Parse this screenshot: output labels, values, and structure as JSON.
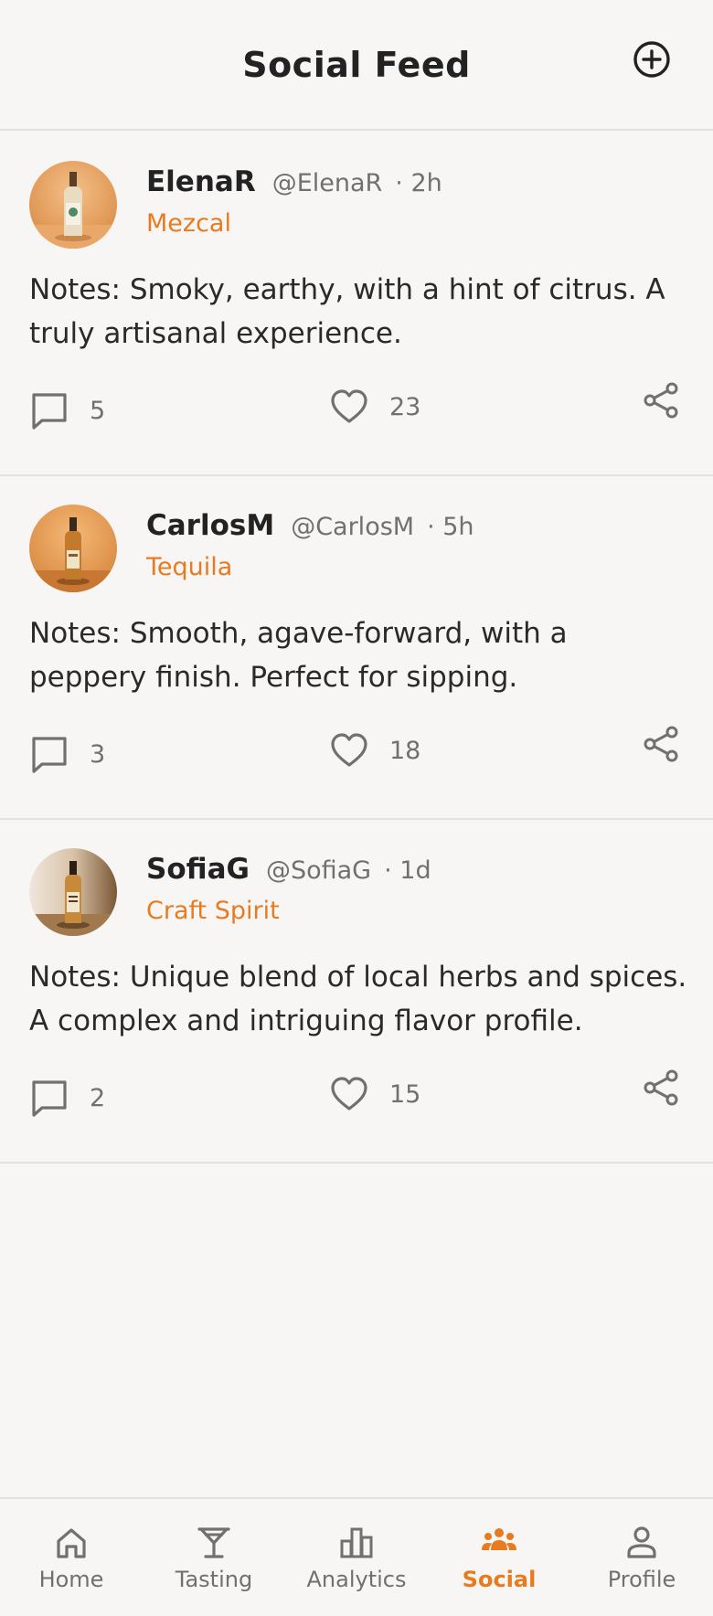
{
  "header": {
    "title": "Social Feed"
  },
  "posts": [
    {
      "username": "ElenaR",
      "handle": "@ElenaR",
      "time": "· 2h",
      "category": "Mezcal",
      "notes": "Notes: Smoky, earthy, with a hint of citrus. A truly artisanal experience.",
      "comments": "5",
      "likes": "23"
    },
    {
      "username": "CarlosM",
      "handle": "@CarlosM",
      "time": "· 5h",
      "category": "Tequila",
      "notes": "Notes: Smooth, agave-forward, with a peppery finish. Perfect for sipping.",
      "comments": "3",
      "likes": "18"
    },
    {
      "username": "SofiaG",
      "handle": "@SofiaG",
      "time": "· 1d",
      "category": "Craft Spirit",
      "notes": "Notes: Unique blend of local herbs and spices. A complex and intriguing flavor profile.",
      "comments": "2",
      "likes": "15"
    }
  ],
  "nav": {
    "items": [
      {
        "label": "Home",
        "icon": "home-icon"
      },
      {
        "label": "Tasting",
        "icon": "cocktail-glass-icon"
      },
      {
        "label": "Analytics",
        "icon": "bar-chart-icon"
      },
      {
        "label": "Social",
        "icon": "group-icon",
        "active": true
      },
      {
        "label": "Profile",
        "icon": "person-icon"
      }
    ]
  },
  "colors": {
    "accent": "#e87a1f",
    "text": "#222222",
    "muted": "#707070",
    "background": "#f8f6f5",
    "divider": "#e4e1df"
  }
}
